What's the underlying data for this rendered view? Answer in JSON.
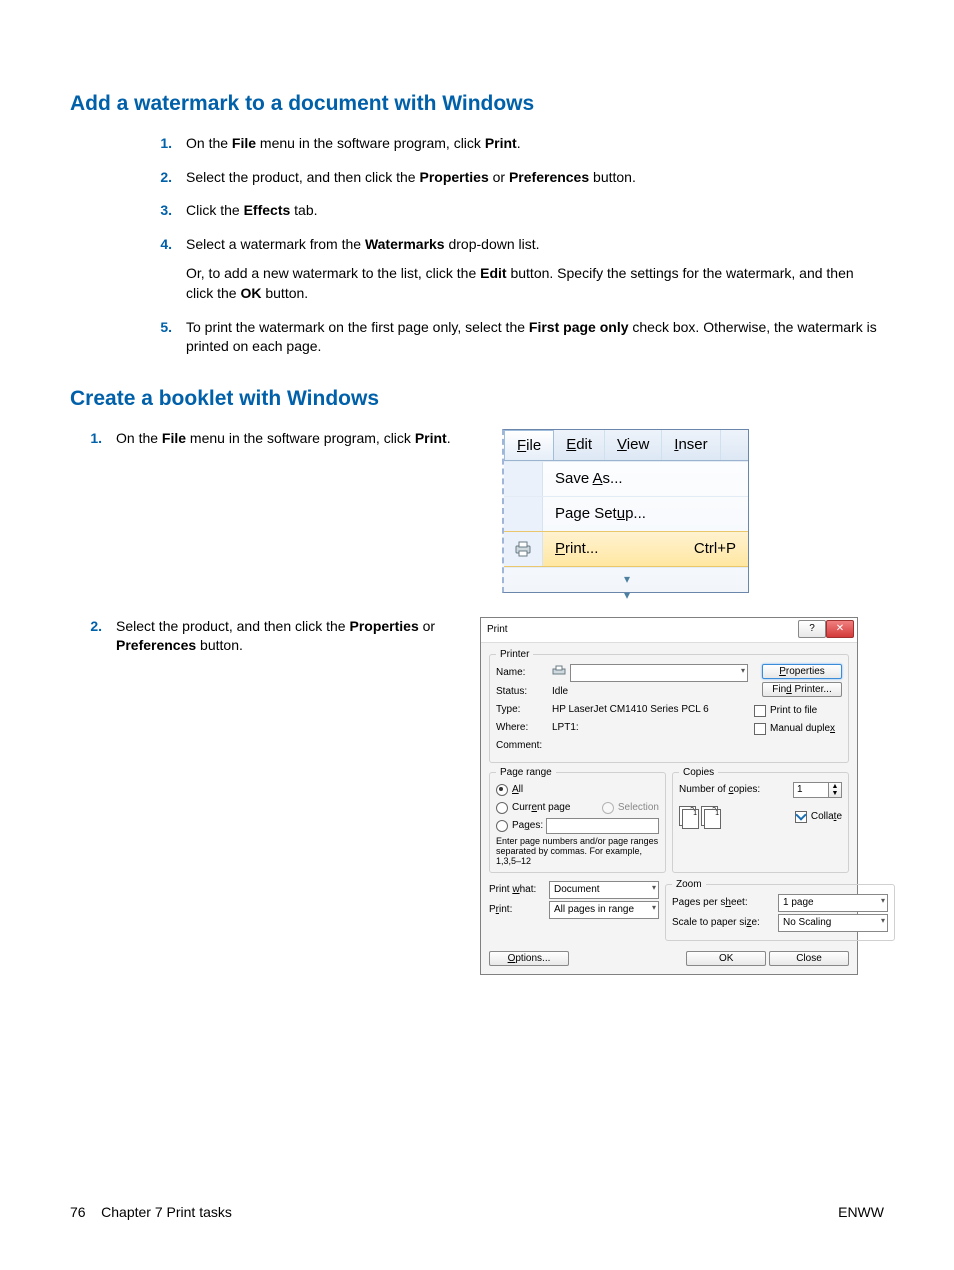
{
  "headings": {
    "h1": "Add a watermark to a document with Windows",
    "h2": "Create a booklet with Windows"
  },
  "watermark_steps": {
    "s1": {
      "num": "1.",
      "a": "On the ",
      "b": "File",
      "c": " menu in the software program, click ",
      "d": "Print",
      "e": "."
    },
    "s2": {
      "num": "2.",
      "a": "Select the product, and then click the ",
      "b": "Properties",
      "c": " or ",
      "d": "Preferences",
      "e": " button."
    },
    "s3": {
      "num": "3.",
      "a": "Click the ",
      "b": "Effects",
      "c": " tab."
    },
    "s4": {
      "num": "4.",
      "a": "Select a watermark from the ",
      "b": "Watermarks",
      "c": " drop-down list.",
      "p2a": "Or, to add a new watermark to the list, click the ",
      "p2b": "Edit",
      "p2c": " button. Specify the settings for the watermark, and then click the ",
      "p2d": "OK",
      "p2e": " button."
    },
    "s5": {
      "num": "5.",
      "a": "To print the watermark on the first page only, select the ",
      "b": "First page only",
      "c": " check box. Otherwise, the watermark is printed on each page."
    }
  },
  "booklet_steps": {
    "s1": {
      "num": "1.",
      "a": "On the ",
      "b": "File",
      "c": " menu in the software program, click ",
      "d": "Print",
      "e": "."
    },
    "s2": {
      "num": "2.",
      "a": "Select the product, and then click the ",
      "b": "Properties",
      "c": " or ",
      "d": "Preferences",
      "e": " button."
    }
  },
  "fig_menu": {
    "menubar": {
      "file": "File",
      "edit": "Edit",
      "view": "View",
      "insert": "Inser"
    },
    "items": {
      "save_as": "Save As...",
      "page_setup": "Page Setup...",
      "print": "Print...",
      "print_shortcut": "Ctrl+P"
    }
  },
  "fig_print": {
    "title": "Print",
    "printer": {
      "legend": "Printer",
      "name_lbl": "Name:",
      "status_lbl": "Status:",
      "status_val": "Idle",
      "type_lbl": "Type:",
      "type_val": "HP LaserJet CM1410 Series PCL 6",
      "where_lbl": "Where:",
      "where_val": "LPT1:",
      "comment_lbl": "Comment:",
      "properties_btn": "Properties",
      "find_btn": "Find Printer...",
      "print_to_file": "Print to file",
      "manual_duplex": "Manual duplex"
    },
    "range": {
      "legend": "Page range",
      "all": "All",
      "current": "Current page",
      "selection": "Selection",
      "pages": "Pages:",
      "hint": "Enter page numbers and/or page ranges separated by commas.  For example, 1,3,5–12"
    },
    "copies": {
      "legend": "Copies",
      "num_lbl": "Number of copies:",
      "num_val": "1",
      "collate": "Collate"
    },
    "printwhat": {
      "lbl1": "Print what:",
      "val1": "Document",
      "lbl2": "Print:",
      "val2": "All pages in range"
    },
    "zoom": {
      "legend": "Zoom",
      "pps_lbl": "Pages per sheet:",
      "pps_val": "1 page",
      "scale_lbl": "Scale to paper size:",
      "scale_val": "No Scaling"
    },
    "buttons": {
      "options": "Options...",
      "ok": "OK",
      "close": "Close"
    }
  },
  "footer": {
    "page": "76",
    "chapter": "Chapter 7   Print tasks",
    "right": "ENWW"
  }
}
